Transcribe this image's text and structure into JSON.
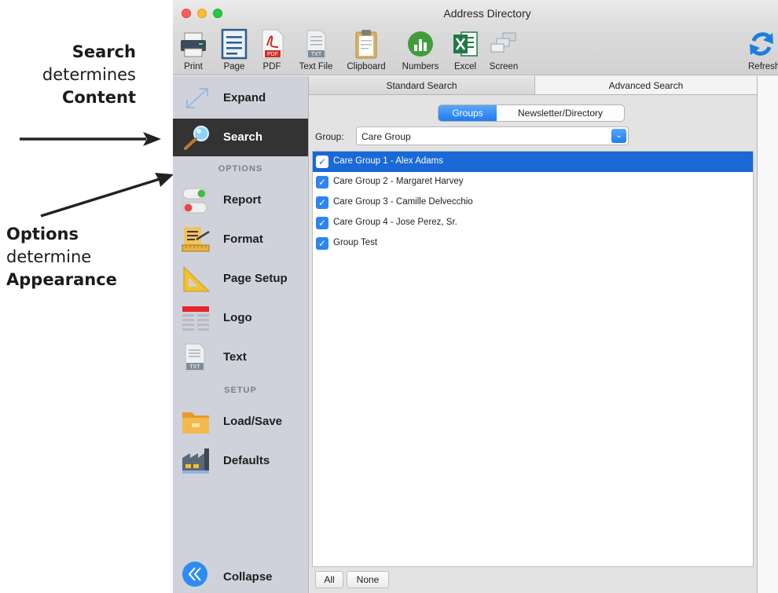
{
  "annotations": {
    "search_line1": "Search",
    "search_line2": "determines",
    "search_line3": "Content",
    "options_line1": "Options",
    "options_line2": "determine",
    "options_line3": "Appearance"
  },
  "window": {
    "title": "Address Directory"
  },
  "toolbar": {
    "print": "Print",
    "page": "Page",
    "pdf": "PDF",
    "textfile": "Text File",
    "clipboard": "Clipboard",
    "numbers": "Numbers",
    "excel": "Excel",
    "screen": "Screen",
    "refresh": "Refresh",
    "pdf_badge": "PDF",
    "txt_badge": "TXT"
  },
  "sidebar": {
    "expand": "Expand",
    "search": "Search",
    "options_header": "OPTIONS",
    "report": "Report",
    "format": "Format",
    "page_setup": "Page Setup",
    "logo": "Logo",
    "text": "Text",
    "text_badge": "TXT",
    "setup_header": "SETUP",
    "load_save": "Load/Save",
    "defaults": "Defaults",
    "collapse": "Collapse"
  },
  "tabs": {
    "standard": "Standard Search",
    "advanced": "Advanced Search"
  },
  "segment": {
    "groups": "Groups",
    "newsletter": "Newsletter/Directory"
  },
  "group_select": {
    "label": "Group:",
    "value": "Care Group"
  },
  "list": {
    "items": [
      {
        "label": "Care Group 1 - Alex Adams",
        "checked": true,
        "selected": true
      },
      {
        "label": "Care Group 2 - Margaret Harvey",
        "checked": true,
        "selected": false
      },
      {
        "label": "Care Group 3 - Camille Delvecchio",
        "checked": true,
        "selected": false
      },
      {
        "label": "Care Group 4 - Jose Perez, Sr.",
        "checked": true,
        "selected": false
      },
      {
        "label": "Group Test",
        "checked": true,
        "selected": false
      }
    ]
  },
  "buttons": {
    "all": "All",
    "none": "None"
  },
  "colors": {
    "accent_blue": "#1e7cf2",
    "selection_blue": "#1a69d6",
    "sidebar_bg": "#cfd2db",
    "sidebar_active": "#333333"
  }
}
